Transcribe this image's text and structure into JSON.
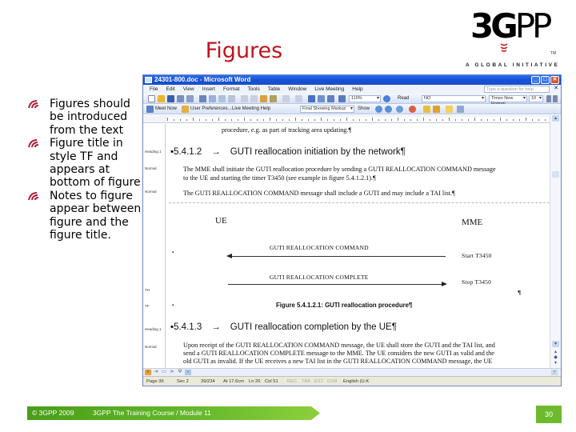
{
  "slide": {
    "title": "Figures",
    "bullets": [
      "Figures should be introduced from the text",
      "Figure title in style TF and appears at bottom of figure",
      "Notes to figure appear between figure and the figure title."
    ],
    "logo": {
      "mark": "3G",
      "mark_pp": "PP",
      "tagline": "A GLOBAL INITIATIVE",
      "tm": "TM"
    },
    "footer": {
      "copyright": "© 3GPP 2009",
      "course": "3GPP The Training Course / Module 11",
      "page_number": "30"
    },
    "colors": {
      "title": "#c0141c",
      "footer_green": "#63b72a",
      "bullet_icon": "#b0203a"
    }
  },
  "word": {
    "title": "24301-800.doc - Microsoft Word",
    "window_buttons": [
      "minimize",
      "maximize",
      "close"
    ],
    "menu": [
      "File",
      "Edit",
      "View",
      "Insert",
      "Format",
      "Tools",
      "Table",
      "Window",
      "Live Meeting",
      "Help"
    ],
    "help_placeholder": "Type a question for help",
    "toolbar1": {
      "zoom": "110%",
      "read_label": "Read",
      "style": "NO",
      "font": "Times New Roman",
      "size": "10"
    },
    "toolbar2": {
      "meet_now": "Meet Now",
      "user_prefs": "User Preferences...",
      "live_meeting_help": "Live Meeting Help",
      "markup_view": "Final Showing Markup",
      "show": "Show"
    },
    "style_labels": [
      "Heading 1",
      "Normal",
      "Normal",
      "TH",
      "TF",
      "Heading 1",
      "Normal"
    ],
    "doc": {
      "line0": "procedure, e.g. as part of tracking area updating.¶",
      "heading1_num": "5.4.1.2",
      "heading1_text": "GUTI reallocation initiation by the network¶",
      "para1_l1": "The MME shall initiate the GUTI reallocation procedure by sending a GUTI REALLOCATION COMMAND message",
      "para1_l2": "to the UE and starting the timer T3450 (see example in figure 5.4.1.2.1).¶",
      "para2": "The GUTI REALLOCATION COMMAND message shall include a GUTI and may include a TAI list.¶",
      "msc": {
        "ue": "UE",
        "mme": "MME",
        "msg1": "GUTI REALLOCATION COMMAND",
        "msg2": "GUTI REALLOCATION COMPLETE",
        "timer1": "Start T3450",
        "timer2": "Stop T3450",
        "pilcrow": "¶"
      },
      "caption": "Figure 5.4.1.2.1: GUTI reallocation procedure¶",
      "heading2_num": "5.4.1.3",
      "heading2_text": "GUTI reallocation completion by the UE¶",
      "para3_l1": "Upon receipt of the GUTI REALLOCATION COMMAND message, the UE shall store the GUTI and the TAI list, and",
      "para3_l2": "send a GUTI REALLOCATION COMPLETE message to the MME. The UE considers the new GUTI as valid and the",
      "para3_l3": "old GUTI as invalid. If the UE receives a new TAI list in the GUTI REALLOCATION COMMAND message, the UE"
    },
    "status": {
      "page": "Page 39",
      "sec": "Sec 2",
      "pages": "39/234",
      "at": "At 17.6cm",
      "ln": "Ln 26",
      "col": "Col 51",
      "rec": "REC",
      "trk": "TRK",
      "ext": "EXT",
      "ovr": "OVR",
      "lang": "English (U.K"
    }
  }
}
